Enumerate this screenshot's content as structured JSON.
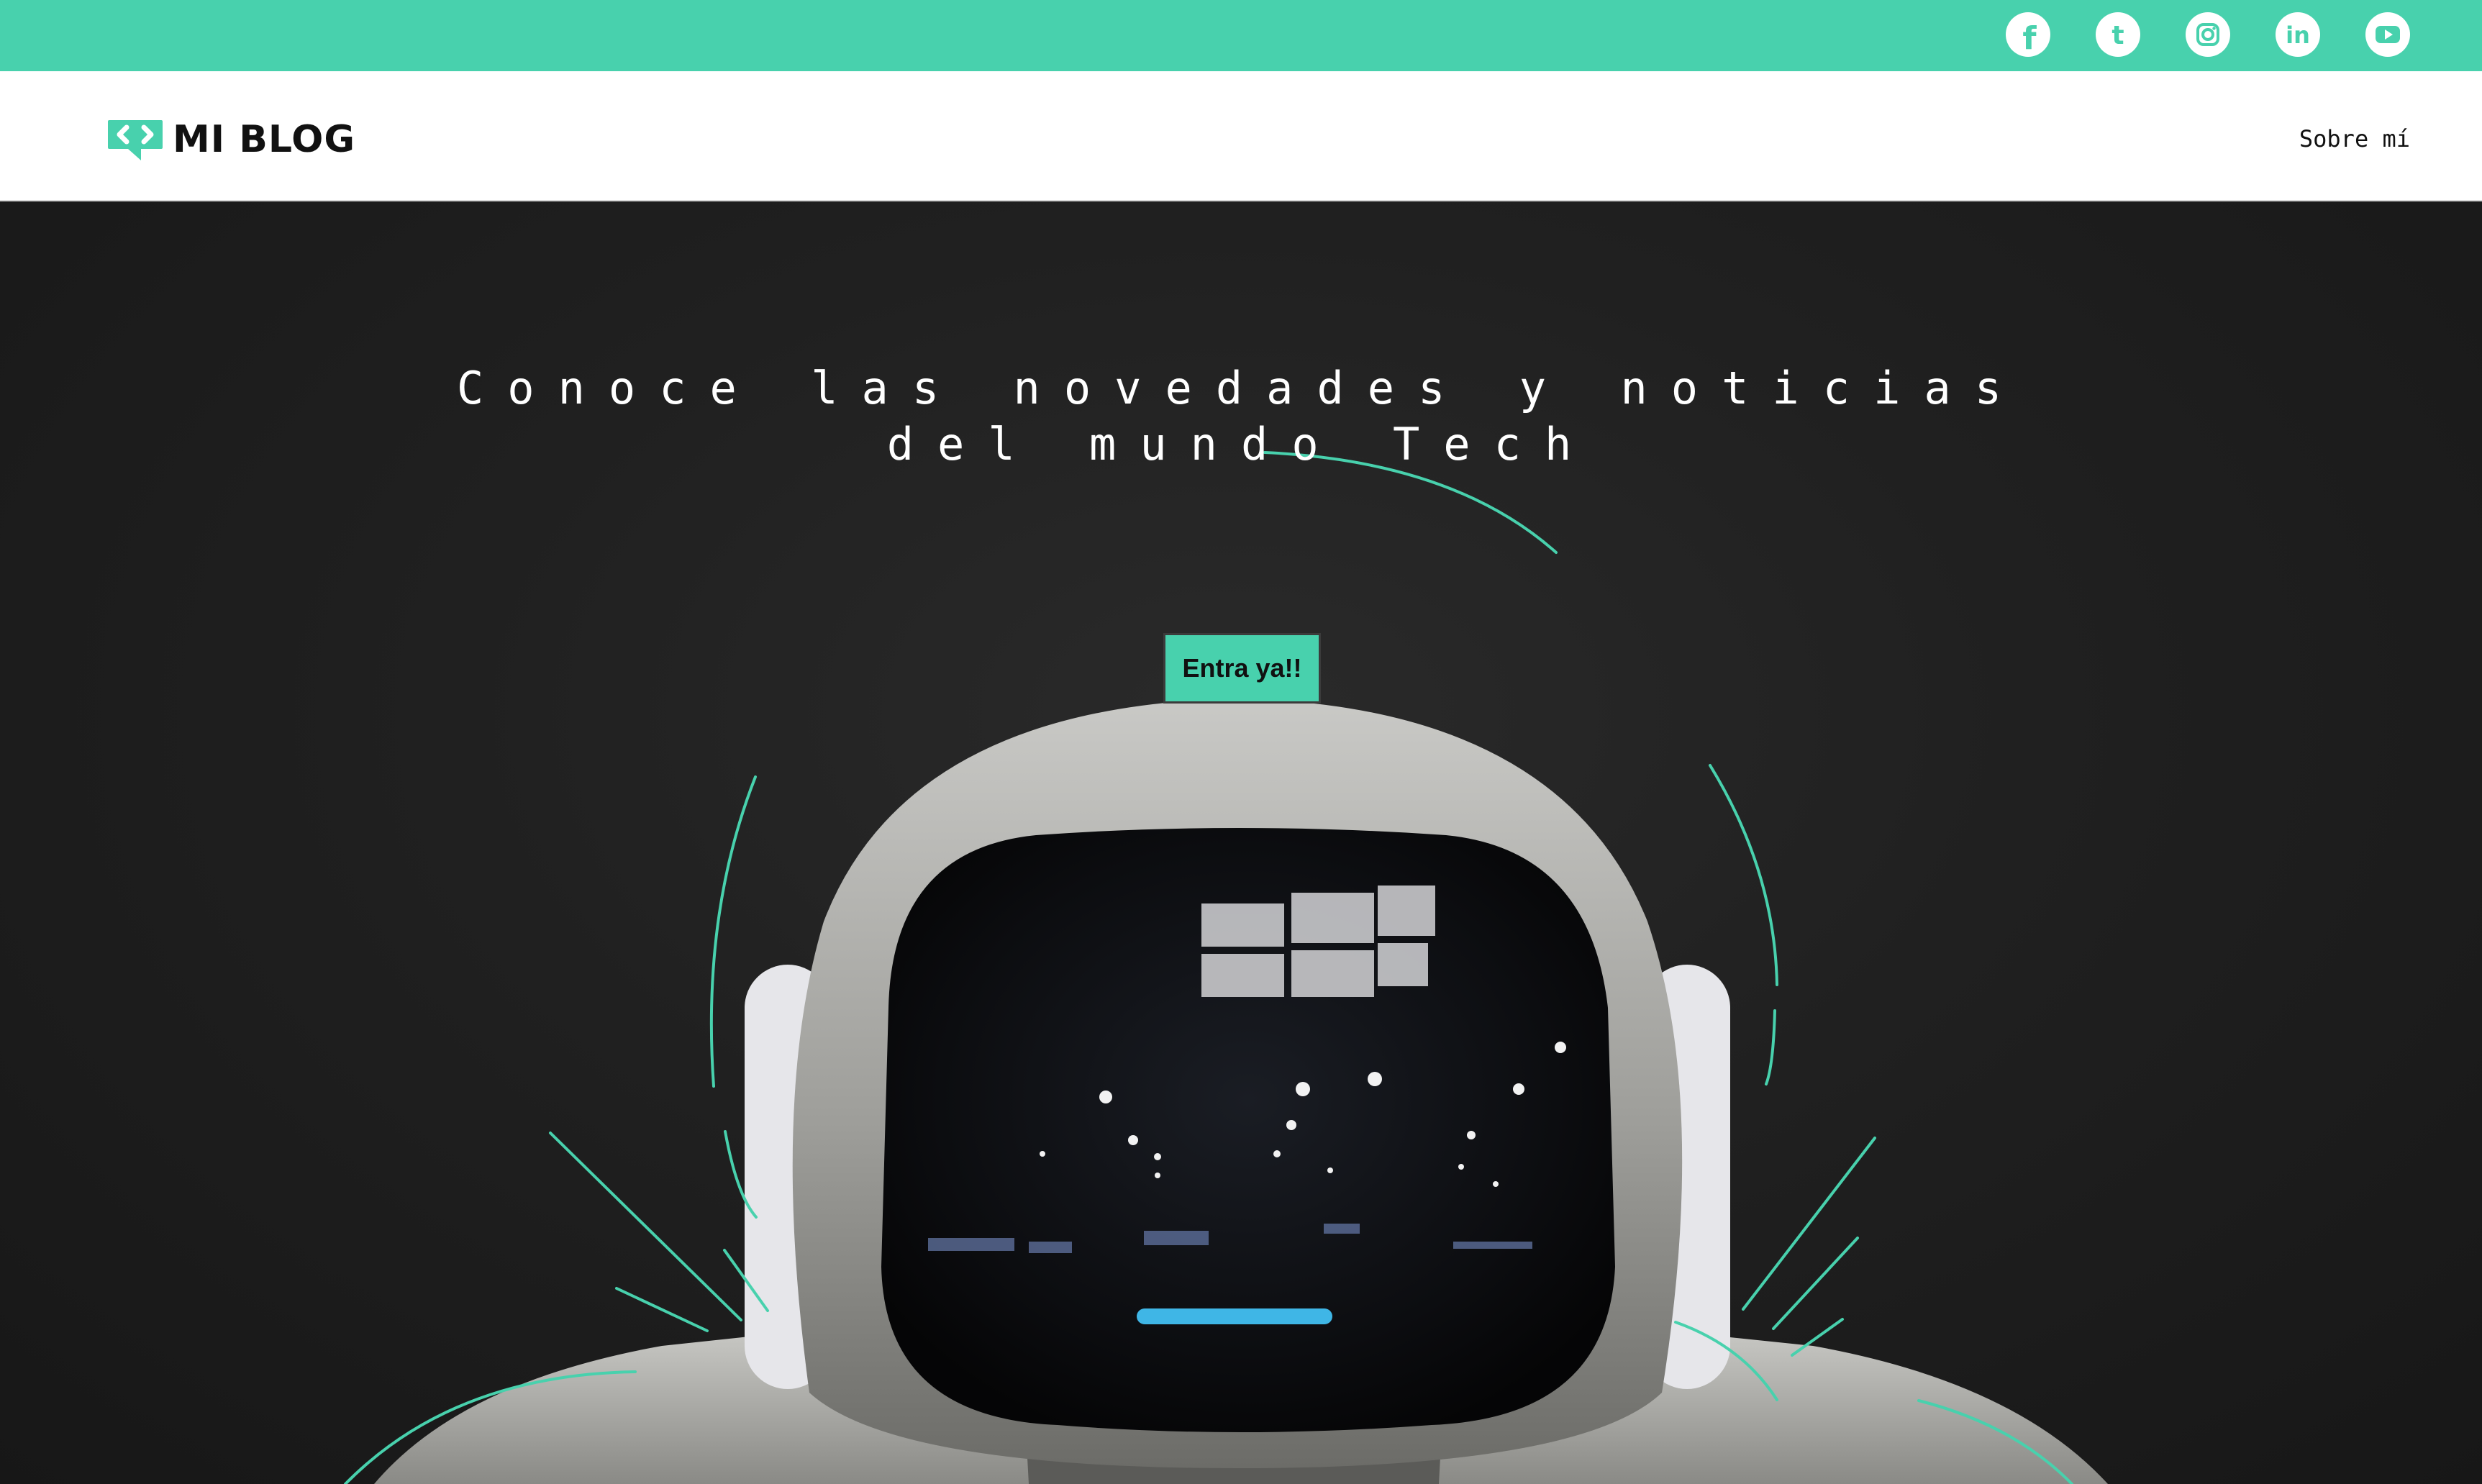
{
  "social_links": [
    {
      "name": "facebook",
      "icon": "facebook-icon",
      "glyph": "f"
    },
    {
      "name": "tumblr",
      "icon": "tumblr-icon",
      "glyph": "t"
    },
    {
      "name": "instagram",
      "icon": "instagram-icon",
      "glyph": ""
    },
    {
      "name": "linkedin",
      "icon": "linkedin-icon",
      "glyph": "in"
    },
    {
      "name": "youtube",
      "icon": "youtube-icon",
      "glyph": ""
    }
  ],
  "header": {
    "logo_text": "MI BLOG",
    "logo_icon": "code-chat-bubble-icon",
    "nav_items": [
      {
        "label": "Sobre mí"
      }
    ]
  },
  "hero": {
    "title": "Conoce las novedades y noticias del mundo Tech",
    "cta_label": "Entra ya!!"
  },
  "colors": {
    "accent": "#48d1ad",
    "header_bg": "#ffffff",
    "hero_bg": "#1e1e1e",
    "text_dark": "#111111",
    "text_light": "#ffffff"
  }
}
